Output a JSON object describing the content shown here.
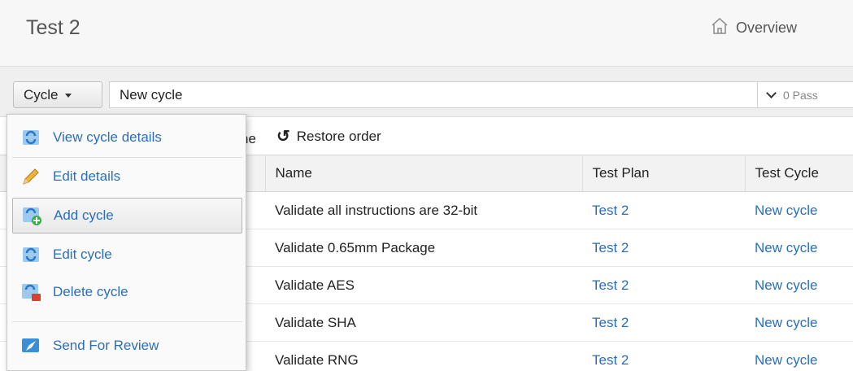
{
  "header": {
    "title": "Test 2",
    "overview_label": "Overview"
  },
  "toolbar": {
    "cycle_button_label": "Cycle",
    "cycle_input_value": "New cycle",
    "status_text": "0 Pass"
  },
  "table_toolbar": {
    "partial_text": "ne",
    "restore_order_label": "Restore order"
  },
  "table": {
    "columns": [
      "",
      "Name",
      "Test Plan",
      "Test Cycle"
    ],
    "rows": [
      {
        "name": "Validate all instructions are 32-bit",
        "plan": "Test 2",
        "cycle": "New cycle"
      },
      {
        "name": "Validate 0.65mm Package",
        "plan": "Test 2",
        "cycle": "New cycle"
      },
      {
        "name": "Validate AES",
        "plan": "Test 2",
        "cycle": "New cycle"
      },
      {
        "name": "Validate SHA",
        "plan": "Test 2",
        "cycle": "New cycle"
      },
      {
        "name": "Validate RNG",
        "plan": "Test 2",
        "cycle": "New cycle"
      }
    ]
  },
  "menu": {
    "items": [
      {
        "label": "View cycle details",
        "icon": "refresh-cycle-icon"
      },
      {
        "label": "Edit details",
        "icon": "pencil-icon"
      },
      {
        "label": "Add cycle",
        "icon": "add-cycle-icon"
      },
      {
        "label": "Edit cycle",
        "icon": "edit-cycle-icon"
      },
      {
        "label": "Delete cycle",
        "icon": "delete-cycle-icon"
      },
      {
        "label": "Send For Review",
        "icon": "send-review-icon"
      }
    ]
  },
  "colors": {
    "link": "#2a6ebb",
    "header_bg": "#f7f7f7",
    "toolbar_bg": "#efefef"
  }
}
